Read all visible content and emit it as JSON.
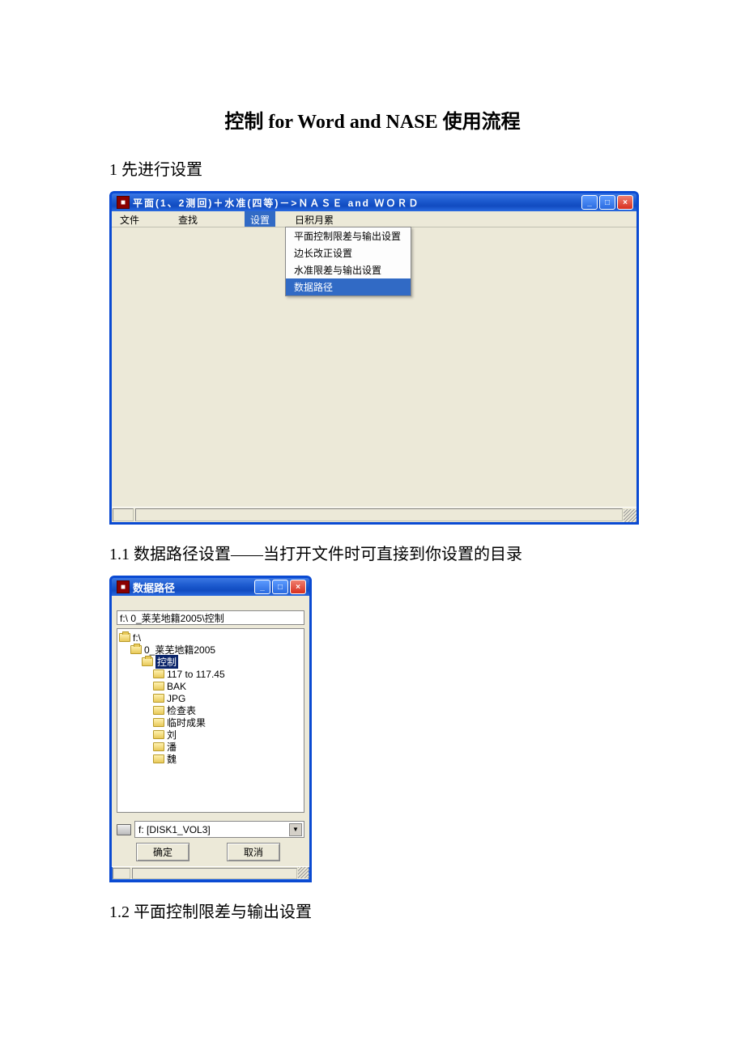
{
  "doc": {
    "title_pre": "控制 ",
    "title_latin": "for Word and NASE ",
    "title_post": "使用流程",
    "h1": "1  先进行设置",
    "h1_1": "1.1  数据路径设置——当打开文件时可直接到你设置的目录",
    "h1_2": "1.2  平面控制限差与输出设置"
  },
  "win1": {
    "title": "平面(1、2测回)＋水准(四等)－>ＮＡＳＥ and ＷＯＲＤ",
    "menu": {
      "file": "文件",
      "find": "查找",
      "set": "设置",
      "riji": "日积月累"
    },
    "dropdown": {
      "pm": "平面控制限差与输出设置",
      "bc": "边长改正设置",
      "sz": "水准限差与输出设置",
      "sj": "数据路径"
    }
  },
  "win2": {
    "title": "数据路径",
    "path": "f:\\ 0_莱芜地籍2005\\控制",
    "tree": {
      "root": "f:\\",
      "n1": "0_莱芜地籍2005",
      "n2": "控制",
      "c0": "117 to 117.45",
      "c1": "BAK",
      "c2": "JPG",
      "c3": "检查表",
      "c4": "临时成果",
      "c5": "刘",
      "c6": "潘",
      "c7": "魏"
    },
    "drive": "f: [DISK1_VOL3]",
    "ok": "确定",
    "cancel": "取消"
  }
}
